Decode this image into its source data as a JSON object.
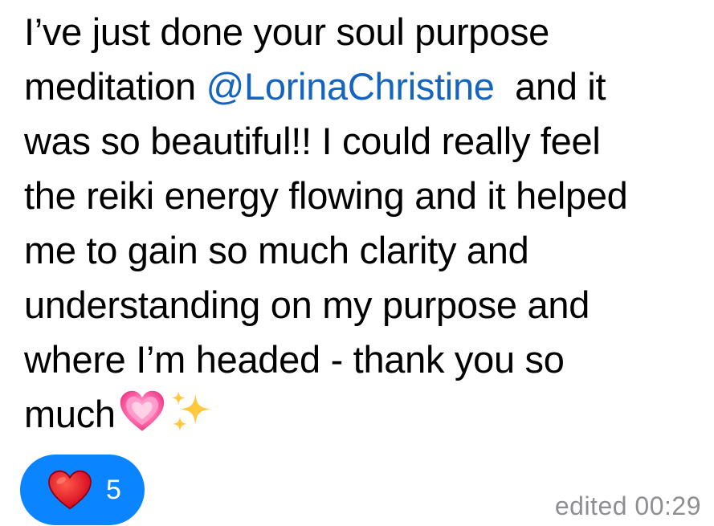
{
  "message": {
    "lines": {
      "line1": "I’ve just done your soul purpose",
      "line2_before": "meditation ",
      "mention": "@LorinaChristine",
      "line2_after": "  and it",
      "line3": "was so beautiful!! I could really feel",
      "line4": "the reiki energy flowing and it helped",
      "line5": "me to gain so much clarity and",
      "line6": "understanding on my purpose and",
      "line7": "where I’m headed - thank you so",
      "line8": "much"
    },
    "emojis": [
      "growing-heart-icon",
      "sparkles-icon"
    ]
  },
  "reaction": {
    "icon": "heart-icon",
    "count": "5"
  },
  "status": {
    "edited_label": "edited 00:29"
  },
  "colors": {
    "mention": "#1565c0",
    "reaction_pill": "#0a84ff",
    "timestamp": "#8e8e93"
  }
}
